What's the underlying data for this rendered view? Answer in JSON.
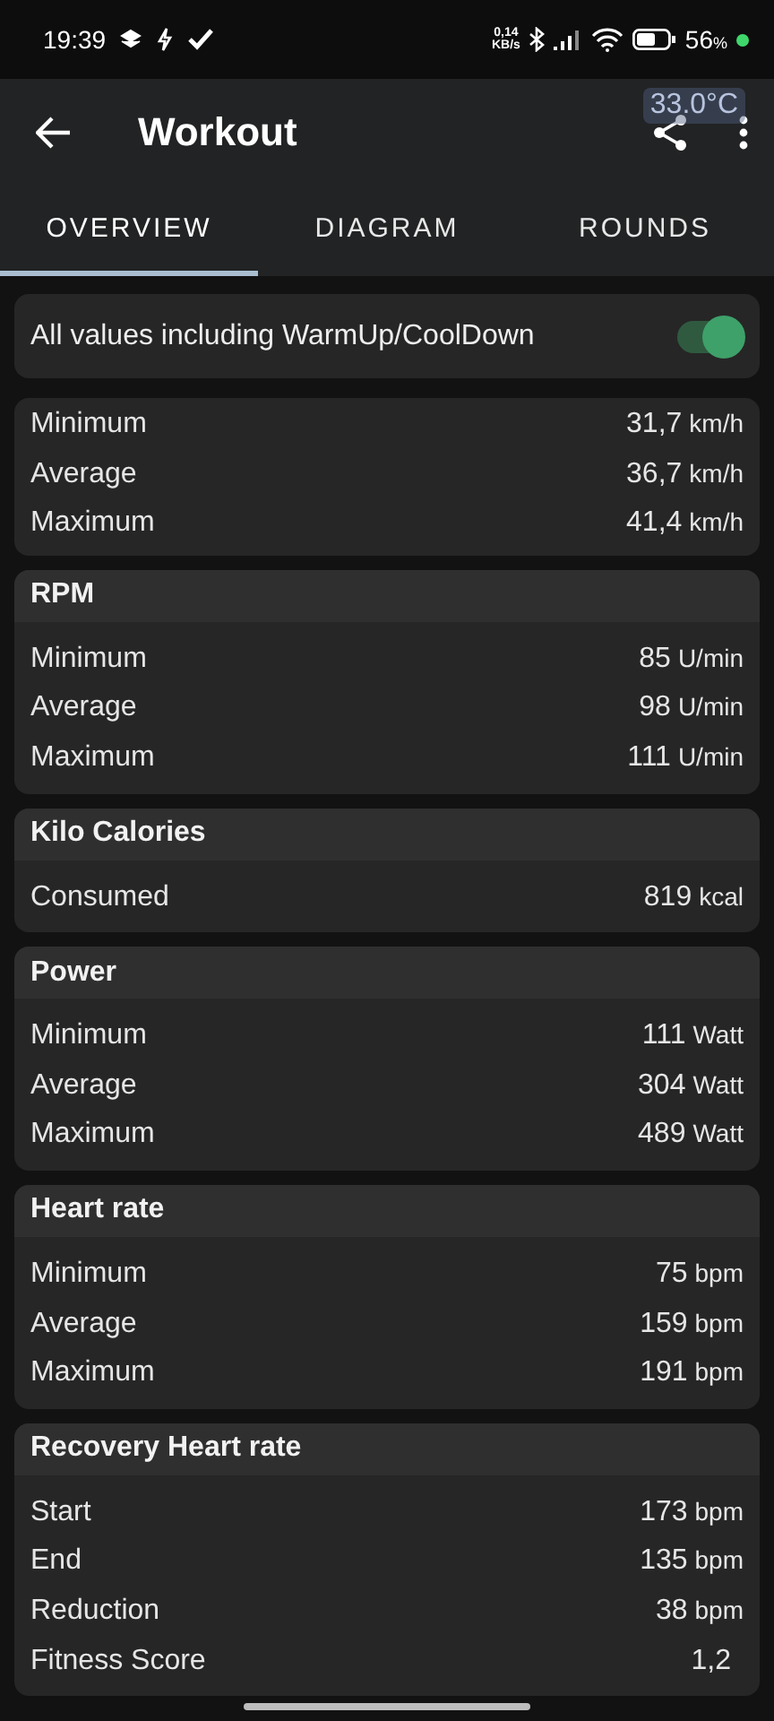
{
  "status_bar": {
    "time": "19:39",
    "net_speed": "0,14",
    "net_unit": "KB/s",
    "battery": "56",
    "battery_unit": "%"
  },
  "app_bar": {
    "title": "Workout",
    "overlay_badge": "33.0°C"
  },
  "tabs": [
    {
      "label": "OVERVIEW",
      "selected": true
    },
    {
      "label": "DIAGRAM",
      "selected": false
    },
    {
      "label": "ROUNDS",
      "selected": false
    }
  ],
  "toggle": {
    "label": "All values including WarmUp/CoolDown",
    "on": true
  },
  "cards": [
    {
      "rows": [
        {
          "label": "Minimum",
          "value": "31,7",
          "unit": "km/h"
        },
        {
          "label": "Average",
          "value": "36,7",
          "unit": "km/h"
        },
        {
          "label": "Maximum",
          "value": "41,4",
          "unit": "km/h"
        }
      ]
    },
    {
      "title": "RPM",
      "rows": [
        {
          "label": "Minimum",
          "value": "85",
          "unit": "U/min"
        },
        {
          "label": "Average",
          "value": "98",
          "unit": "U/min"
        },
        {
          "label": "Maximum",
          "value": "111",
          "unit": "U/min"
        }
      ]
    },
    {
      "title": "Kilo Calories",
      "rows": [
        {
          "label": "Consumed",
          "value": "819",
          "unit": "kcal"
        }
      ]
    },
    {
      "title": "Power",
      "rows": [
        {
          "label": "Minimum",
          "value": "111",
          "unit": "Watt"
        },
        {
          "label": "Average",
          "value": "304",
          "unit": "Watt"
        },
        {
          "label": "Maximum",
          "value": "489",
          "unit": "Watt"
        }
      ]
    },
    {
      "title": "Heart rate",
      "rows": [
        {
          "label": "Minimum",
          "value": "75",
          "unit": "bpm"
        },
        {
          "label": "Average",
          "value": "159",
          "unit": "bpm"
        },
        {
          "label": "Maximum",
          "value": "191",
          "unit": "bpm"
        }
      ]
    },
    {
      "title": "Recovery Heart rate",
      "rows": [
        {
          "label": "Start",
          "value": "173",
          "unit": "bpm"
        },
        {
          "label": "End",
          "value": "135",
          "unit": "bpm"
        },
        {
          "label": "Reduction",
          "value": "38",
          "unit": "bpm"
        },
        {
          "label": "Fitness Score",
          "value": "1,2"
        }
      ]
    }
  ]
}
